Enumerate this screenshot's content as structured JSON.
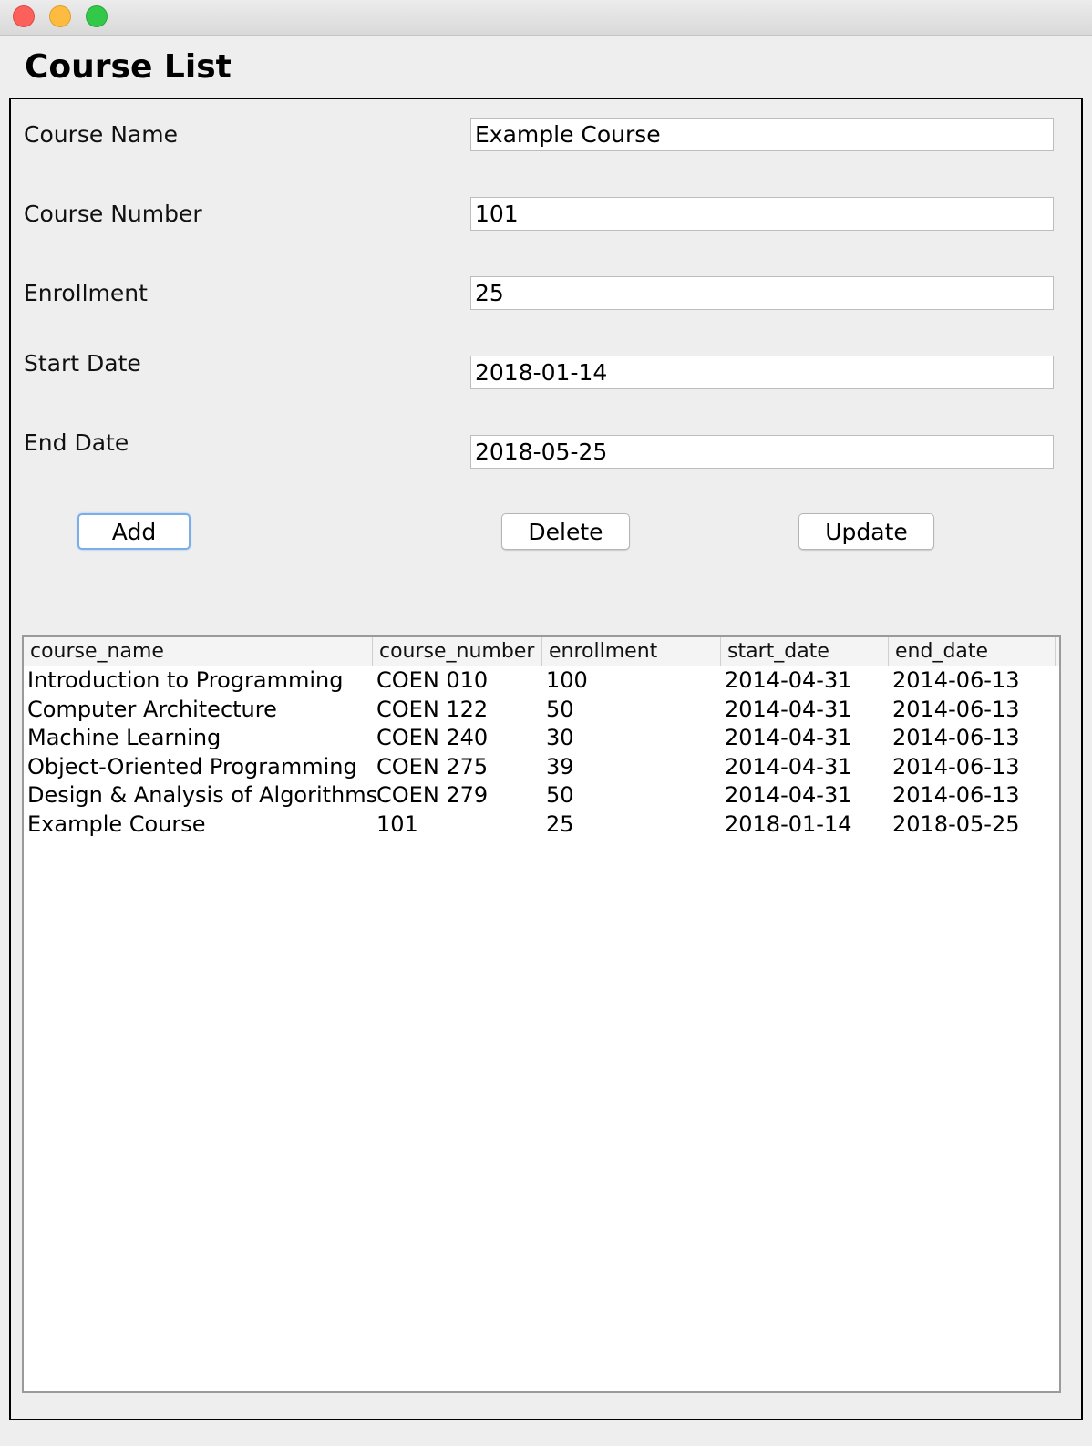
{
  "window": {
    "controls": [
      "close",
      "minimize",
      "maximize"
    ]
  },
  "page": {
    "title": "Course List"
  },
  "form": {
    "fields": [
      {
        "label": "Course Name",
        "value": "Example Course"
      },
      {
        "label": "Course Number",
        "value": "101"
      },
      {
        "label": "Enrollment",
        "value": "25"
      },
      {
        "label": "Start Date",
        "value": "2018-01-14"
      },
      {
        "label": "End Date",
        "value": "2018-05-25"
      }
    ]
  },
  "buttons": {
    "add": "Add",
    "delete": "Delete",
    "update": "Update"
  },
  "table": {
    "columns": [
      "course_name",
      "course_number",
      "enrollment",
      "start_date",
      "end_date"
    ],
    "rows": [
      [
        "Introduction to Programming",
        "COEN 010",
        "100",
        "2014-04-31",
        "2014-06-13"
      ],
      [
        "Computer Architecture",
        "COEN 122",
        "50",
        "2014-04-31",
        "2014-06-13"
      ],
      [
        "Machine Learning",
        "COEN 240",
        "30",
        "2014-04-31",
        "2014-06-13"
      ],
      [
        "Object-Oriented Programming",
        "COEN 275",
        "39",
        "2014-04-31",
        "2014-06-13"
      ],
      [
        "Design & Analysis of Algorithms",
        "COEN 279",
        "50",
        "2014-04-31",
        "2014-06-13"
      ],
      [
        "Example Course",
        "101",
        "25",
        "2018-01-14",
        "2018-05-25"
      ]
    ]
  }
}
